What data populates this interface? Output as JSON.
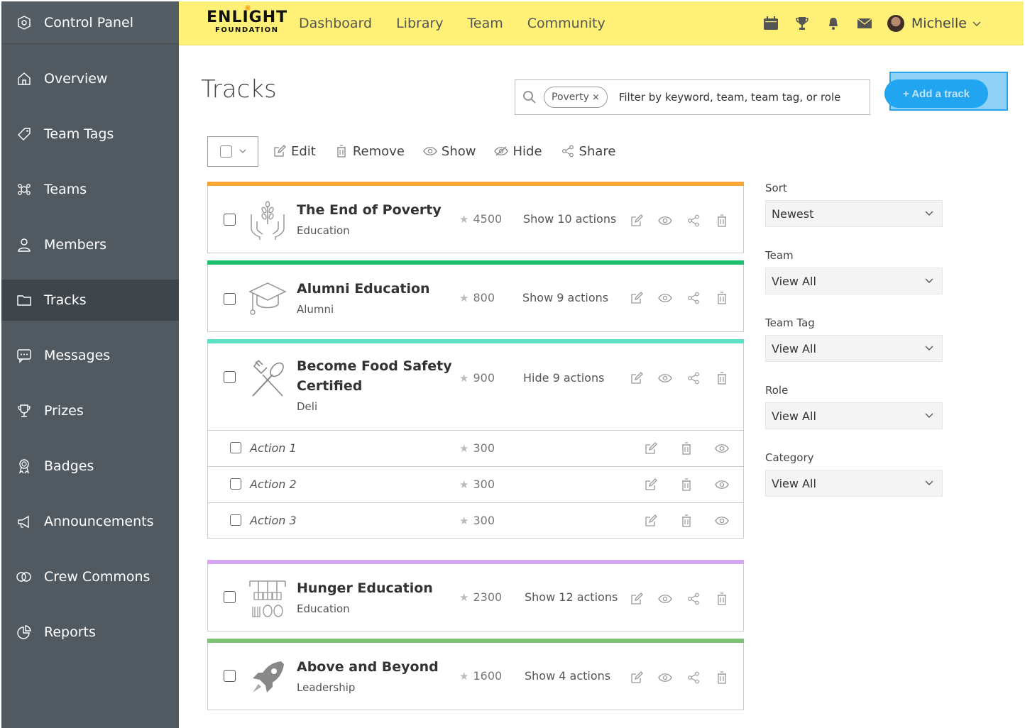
{
  "sidebar": {
    "header": {
      "label": "Control Panel",
      "icon": "gear-shield-icon"
    },
    "items": [
      {
        "label": "Overview",
        "icon": "home-icon",
        "active": false
      },
      {
        "label": "Team Tags",
        "icon": "tag-icon",
        "active": false
      },
      {
        "label": "Teams",
        "icon": "teams-icon",
        "active": false
      },
      {
        "label": "Members",
        "icon": "user-icon",
        "active": false
      },
      {
        "label": "Tracks",
        "icon": "folder-icon",
        "active": true
      },
      {
        "label": "Messages",
        "icon": "chat-icon",
        "active": false
      },
      {
        "label": "Prizes",
        "icon": "trophy-icon",
        "active": false
      },
      {
        "label": "Badges",
        "icon": "badge-icon",
        "active": false
      },
      {
        "label": "Announcements",
        "icon": "megaphone-icon",
        "active": false
      },
      {
        "label": "Crew Commons",
        "icon": "rings-icon",
        "active": false
      },
      {
        "label": "Reports",
        "icon": "pie-chart-icon",
        "active": false
      }
    ]
  },
  "header": {
    "logo_big": "ENLIGHT",
    "logo_small": "FOUNDATION",
    "nav": [
      "Dashboard",
      "Library",
      "Team",
      "Community"
    ],
    "user_name": "Michelle"
  },
  "main": {
    "title": "Tracks",
    "search": {
      "chip": "Poverty",
      "placeholder": "Filter by keyword, team, team tag, or role"
    },
    "add_button": "+ Add a track",
    "toolbar": {
      "edit": "Edit",
      "remove": "Remove",
      "show": "Show",
      "hide": "Hide",
      "share": "Share"
    }
  },
  "tracks": [
    {
      "title": "The End of Poverty",
      "category": "Education",
      "points": "4500",
      "actions": "Show 10 actions",
      "color": "#f7a535"
    },
    {
      "title": "Alumni Education",
      "category": "Alumni",
      "points": "800",
      "actions": "Show 9 actions",
      "color": "#1ebf6f"
    },
    {
      "title": "Become Food Safety Certified",
      "category": "Deli",
      "points": "900",
      "actions": "Hide 9 actions",
      "color": "#5de0c4",
      "subactions": [
        {
          "name": "Action 1",
          "points": "300"
        },
        {
          "name": "Action 2",
          "points": "300"
        },
        {
          "name": "Action 3",
          "points": "300"
        }
      ]
    },
    {
      "title": "Hunger Education",
      "category": "Education",
      "points": "2300",
      "actions": "Show 12 actions",
      "color": "#d7a8f2"
    },
    {
      "title": "Above and Beyond",
      "category": "Leadership",
      "points": "1600",
      "actions": "Show 4 actions",
      "color": "#7ec278"
    }
  ],
  "filters": [
    {
      "label": "Sort",
      "value": "Newest"
    },
    {
      "label": "Team",
      "value": "View All"
    },
    {
      "label": "Team Tag",
      "value": "View All"
    },
    {
      "label": "Role",
      "value": "View All"
    },
    {
      "label": "Category",
      "value": "View All"
    }
  ]
}
